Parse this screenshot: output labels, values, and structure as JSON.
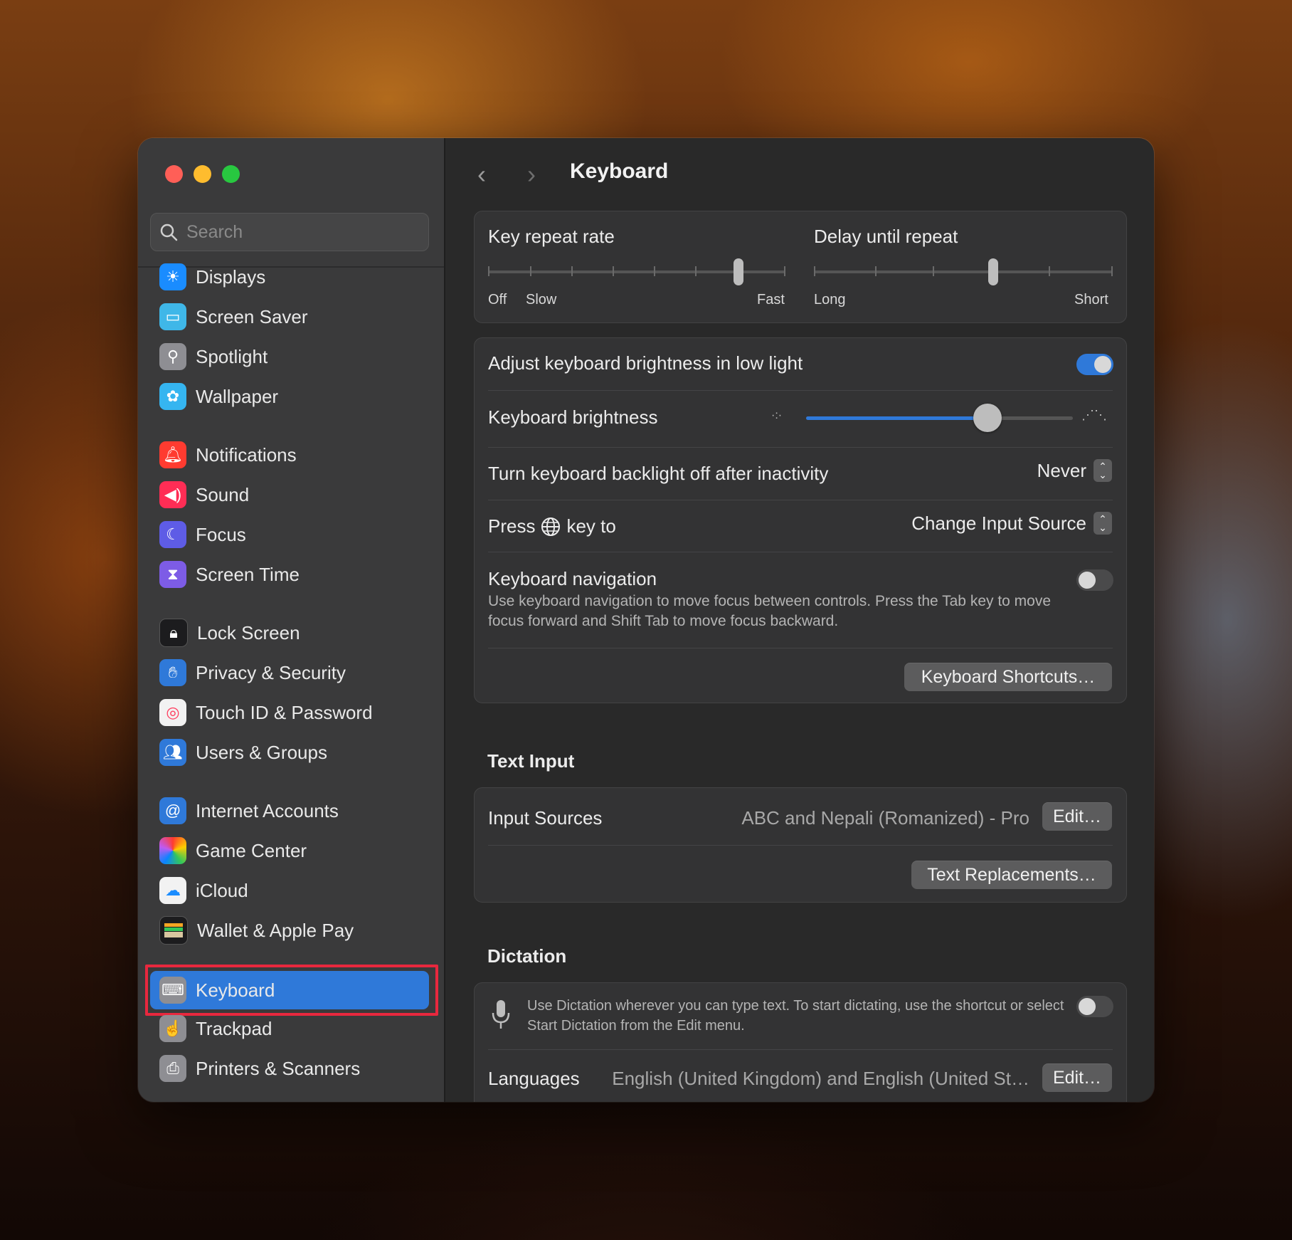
{
  "sidebar": {
    "search_placeholder": "Search",
    "items": [
      {
        "label": "Displays",
        "icon": "sun-icon",
        "color": "#1a8cff"
      },
      {
        "label": "Screen Saver",
        "icon": "screen-saver-icon",
        "color": "#3fb7e8"
      },
      {
        "label": "Spotlight",
        "icon": "magnifier-icon",
        "color": "#8e8e93"
      },
      {
        "label": "Wallpaper",
        "icon": "flower-icon",
        "color": "#35b5f0"
      },
      {
        "label": "Notifications",
        "icon": "bell-icon",
        "color": "#ff3b30"
      },
      {
        "label": "Sound",
        "icon": "speaker-icon",
        "color": "#ff2d55"
      },
      {
        "label": "Focus",
        "icon": "moon-icon",
        "color": "#5e5ce6"
      },
      {
        "label": "Screen Time",
        "icon": "hourglass-icon",
        "color": "#7d5ce6"
      },
      {
        "label": "Lock Screen",
        "icon": "lock-icon",
        "color": "#1c1c1e"
      },
      {
        "label": "Privacy & Security",
        "icon": "hand-icon",
        "color": "#2f79d9"
      },
      {
        "label": "Touch ID & Password",
        "icon": "fingerprint-icon",
        "color": "#f2f2f2"
      },
      {
        "label": "Users & Groups",
        "icon": "users-icon",
        "color": "#2f79d9"
      },
      {
        "label": "Internet Accounts",
        "icon": "at-icon",
        "color": "#2f79d9"
      },
      {
        "label": "Game Center",
        "icon": "game-center-icon",
        "color": "#f2f2f2"
      },
      {
        "label": "iCloud",
        "icon": "cloud-icon",
        "color": "#f2f2f2"
      },
      {
        "label": "Wallet & Apple Pay",
        "icon": "wallet-icon",
        "color": "#1c1c1e"
      },
      {
        "label": "Keyboard",
        "icon": "keyboard-icon",
        "color": "#8e8e93",
        "selected": true
      },
      {
        "label": "Trackpad",
        "icon": "trackpad-icon",
        "color": "#8e8e93"
      },
      {
        "label": "Printers & Scanners",
        "icon": "printer-icon",
        "color": "#8e8e93"
      }
    ]
  },
  "main": {
    "title": "Keyboard",
    "key_repeat": {
      "label": "Key repeat rate",
      "off": "Off",
      "slow": "Slow",
      "fast": "Fast",
      "level": 0.8571
    },
    "delay_repeat": {
      "label": "Delay until repeat",
      "long": "Long",
      "short": "Short",
      "level": 0.6
    },
    "brightness_low_light": {
      "label": "Adjust keyboard brightness in low light",
      "on": true
    },
    "keyboard_brightness": {
      "label": "Keyboard brightness",
      "level": 0.68
    },
    "backlight_off": {
      "label": "Turn keyboard backlight off after inactivity",
      "value": "Never"
    },
    "press_key": {
      "label_pre": "Press",
      "label_post": "key to",
      "value": "Change Input Source"
    },
    "keyboard_navigation": {
      "label": "Keyboard navigation",
      "description": "Use keyboard navigation to move focus between controls. Press the Tab key to move focus forward and Shift Tab to move focus backward.",
      "on": false
    },
    "shortcuts_button": "Keyboard Shortcuts…",
    "text_input": {
      "heading": "Text Input",
      "input_sources_label": "Input Sources",
      "input_sources_value": "ABC and Nepali (Romanized) - Pro",
      "edit_button": "Edit…",
      "replacements_button": "Text Replacements…"
    },
    "dictation": {
      "heading": "Dictation",
      "description": "Use Dictation wherever you can type text. To start dictating, use the shortcut or select Start Dictation from the Edit menu.",
      "on": false,
      "languages_label": "Languages",
      "languages_value": "English (United Kingdom) and English (United St…",
      "edit_button": "Edit…"
    }
  }
}
